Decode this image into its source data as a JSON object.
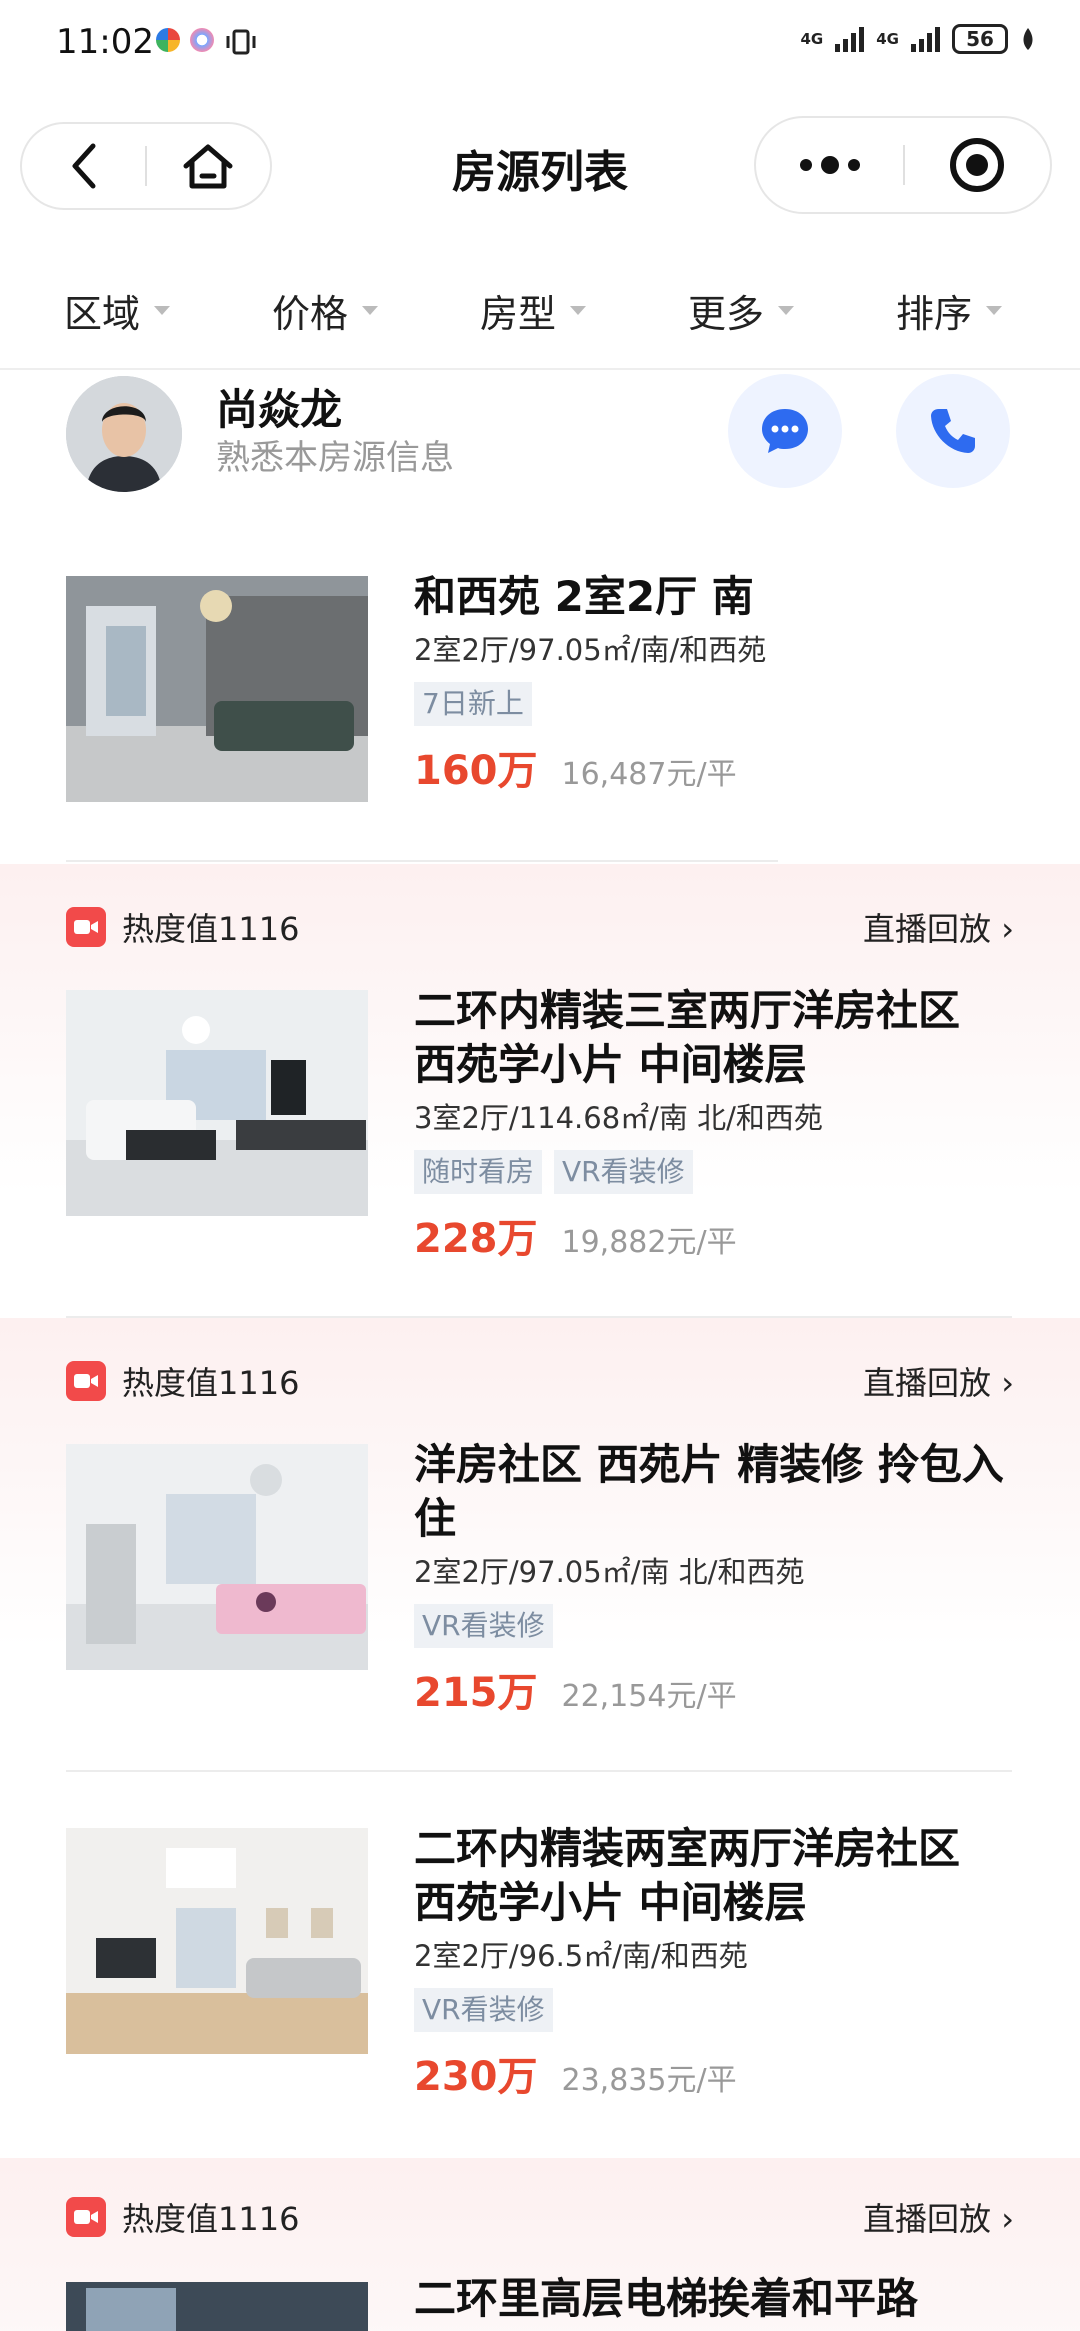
{
  "status_bar": {
    "time": "11:02",
    "net1": "4G",
    "net2": "4G",
    "battery": "56"
  },
  "header": {
    "title": "房源列表"
  },
  "filters": [
    {
      "label": "区域"
    },
    {
      "label": "价格"
    },
    {
      "label": "房型"
    },
    {
      "label": "更多"
    },
    {
      "label": "排序"
    }
  ],
  "agent": {
    "name": "尚焱龙",
    "subtitle": "熟悉本房源信息"
  },
  "listings": [
    {
      "title": "和西苑 2室2厅 南",
      "spec": "2室2厅/97.05㎡/南/和西苑",
      "tags": [
        "7日新上"
      ],
      "price": "160万",
      "unit_price": "16,487元/平"
    },
    {
      "heat": "热度值1116",
      "replay": "直播回放 ›",
      "title": "二环内精装三室两厅洋房社区 西苑学小片 中间楼层",
      "spec": "3室2厅/114.68㎡/南 北/和西苑",
      "tags": [
        "随时看房",
        "VR看装修"
      ],
      "price": "228万",
      "unit_price": "19,882元/平"
    },
    {
      "heat": "热度值1116",
      "replay": "直播回放 ›",
      "title": "洋房社区 西苑片 精装修 拎包入住",
      "spec": "2室2厅/97.05㎡/南 北/和西苑",
      "tags": [
        "VR看装修"
      ],
      "price": "215万",
      "unit_price": "22,154元/平"
    },
    {
      "title": "二环内精装两室两厅洋房社区 西苑学小片 中间楼层",
      "spec": "2室2厅/96.5㎡/南/和西苑",
      "tags": [
        "VR看装修"
      ],
      "price": "230万",
      "unit_price": "23,835元/平"
    },
    {
      "heat": "热度值1116",
      "replay": "直播回放 ›",
      "title": "二环里高层电梯挨着和平路"
    }
  ],
  "colors": {
    "price": "#e8482e",
    "hot": "#f24a4a",
    "tag_bg": "#eef1f5",
    "tag_text": "#7d8da1",
    "action_blue": "#2e6bf0"
  }
}
